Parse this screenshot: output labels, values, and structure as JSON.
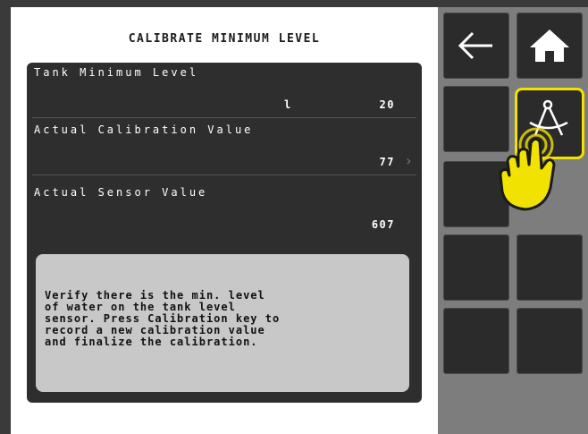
{
  "title": "CALIBRATE MINIMUM LEVEL",
  "rows": [
    {
      "label": "Tank Minimum Level",
      "unit": "l",
      "value": "20"
    },
    {
      "label": "Actual Calibration Value",
      "value": "77",
      "chevron": "›"
    },
    {
      "label": "Actual Sensor Value",
      "value": "607"
    }
  ],
  "message": "Verify there is the min. level\nof water on the tank level\nsensor. Press Calibration key to\nrecord a new calibration value\nand finalize the calibration.",
  "keys": {
    "back_icon": "back-arrow-icon",
    "home_icon": "home-icon",
    "calibration_icon": "compass-calibration-icon"
  },
  "colors": {
    "highlight": "#f2e200",
    "panel": "#2e2e2e",
    "message_bg": "#c8c8c8",
    "sidebar": "#7d7d7d"
  }
}
